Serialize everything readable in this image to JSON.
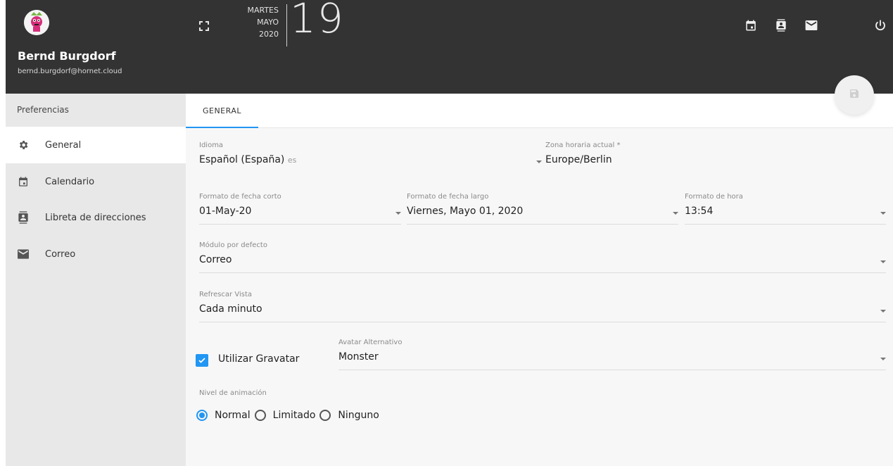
{
  "user": {
    "name": "Bernd Burgdorf",
    "email": "bernd.burgdorf@hornet.cloud"
  },
  "header": {
    "weekday": "MARTES",
    "month": "MAYO",
    "year": "2020",
    "day": "19"
  },
  "sidebar": {
    "title": "Preferencias",
    "items": [
      {
        "label": "General",
        "icon": "gear-icon"
      },
      {
        "label": "Calendario",
        "icon": "calendar-icon"
      },
      {
        "label": "Libreta de direcciones",
        "icon": "contacts-icon"
      },
      {
        "label": "Correo",
        "icon": "mail-icon"
      }
    ]
  },
  "tabs": [
    {
      "label": "GENERAL"
    }
  ],
  "form": {
    "language": {
      "label": "Idioma",
      "value": "Español (España)",
      "suffix": "es"
    },
    "timezone": {
      "label": "Zona horaria actual *",
      "value": "Europe/Berlin"
    },
    "short_date": {
      "label": "Formato de fecha corto",
      "value": "01-May-20"
    },
    "long_date": {
      "label": "Formato de fecha largo",
      "value": "Viernes, Mayo 01, 2020"
    },
    "time_format": {
      "label": "Formato de hora",
      "value": "13:54"
    },
    "default_module": {
      "label": "Módulo por defecto",
      "value": "Correo"
    },
    "refresh": {
      "label": "Refrescar Vista",
      "value": "Cada minuto"
    },
    "gravatar": {
      "label": "Utilizar Gravatar",
      "checked": true
    },
    "avatar_alt": {
      "label": "Avatar Alternativo",
      "value": "Monster"
    },
    "animation": {
      "label": "Nivel de animación",
      "options": [
        "Normal",
        "Limitado",
        "Ninguno"
      ],
      "selected": "Normal"
    }
  },
  "colors": {
    "accent": "#2196f3",
    "topbar": "#333333",
    "sidebar": "#e8e8e8"
  }
}
